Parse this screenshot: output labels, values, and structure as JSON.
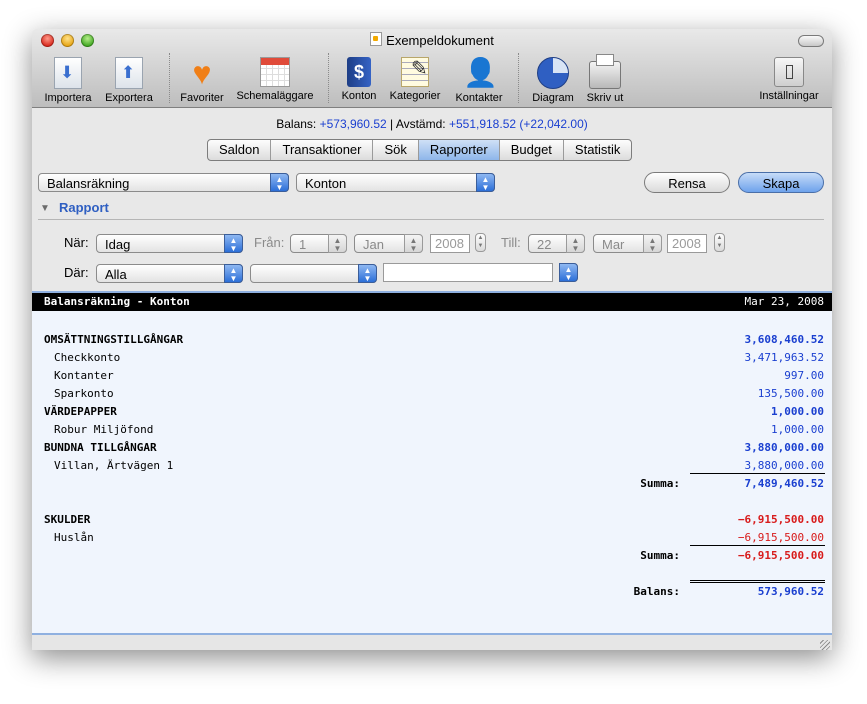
{
  "window": {
    "title": "Exempeldokument"
  },
  "toolbar": {
    "importera": "Importera",
    "exportera": "Exportera",
    "favoriter": "Favoriter",
    "schemalaggare": "Schemaläggare",
    "konton": "Konton",
    "kategorier": "Kategorier",
    "kontakter": "Kontakter",
    "diagram": "Diagram",
    "skriv_ut": "Skriv ut",
    "installningar": "Inställningar",
    "konton_glyph": "$"
  },
  "status": {
    "balans_label": "Balans:",
    "balans_value": "+573,960.52",
    "separator": "|",
    "avstamd_label": "Avstämd:",
    "avstamd_value": "+551,918.52",
    "diff_value": "(+22,042.00)"
  },
  "tabs": [
    "Saldon",
    "Transaktioner",
    "Sök",
    "Rapporter",
    "Budget",
    "Statistik"
  ],
  "active_tab": "Rapporter",
  "controls": {
    "report_type": "Balansräkning",
    "report_group": "Konton",
    "rensa": "Rensa",
    "skapa": "Skapa",
    "section_label": "Rapport",
    "nar_label": "När:",
    "nar_value": "Idag",
    "fran_label": "Från:",
    "fran_day": "1",
    "fran_month": "Jan",
    "fran_year": "2008",
    "till_label": "Till:",
    "till_day": "22",
    "till_month": "Mar",
    "till_year": "2008",
    "dar_label": "Där:",
    "dar_value": "Alla",
    "dar_field2": "",
    "dar_text": ""
  },
  "report": {
    "title": "Balansräkning - Konton",
    "date": "Mar 23, 2008",
    "rows": [
      {
        "name": "OMSÄTTNINGSTILLGÅNGAR",
        "value": "3,608,460.52"
      },
      {
        "name": "Checkkonto",
        "value": "3,471,963.52"
      },
      {
        "name": "Kontanter",
        "value": "997.00"
      },
      {
        "name": "Sparkonto",
        "value": "135,500.00"
      },
      {
        "name": "VÄRDEPAPPER",
        "value": "1,000.00"
      },
      {
        "name": "Robur Miljöfond",
        "value": "1,000.00"
      },
      {
        "name": "BUNDNA TILLGÅNGAR",
        "value": "3,880,000.00"
      },
      {
        "name": "Villan, Ärtvägen 1",
        "value": "3,880,000.00"
      },
      {
        "name": "Summa:",
        "value": "7,489,460.52"
      },
      {
        "name": "SKULDER",
        "value": "−6,915,500.00"
      },
      {
        "name": "Huslån",
        "value": "−6,915,500.00"
      },
      {
        "name": "Summa:",
        "value": "−6,915,500.00"
      },
      {
        "name": "Balans:",
        "value": "573,960.52"
      }
    ]
  },
  "colors": {
    "positive": "#1a3fd0",
    "negative": "#d81b1b",
    "accent": "#2f5fc2"
  }
}
